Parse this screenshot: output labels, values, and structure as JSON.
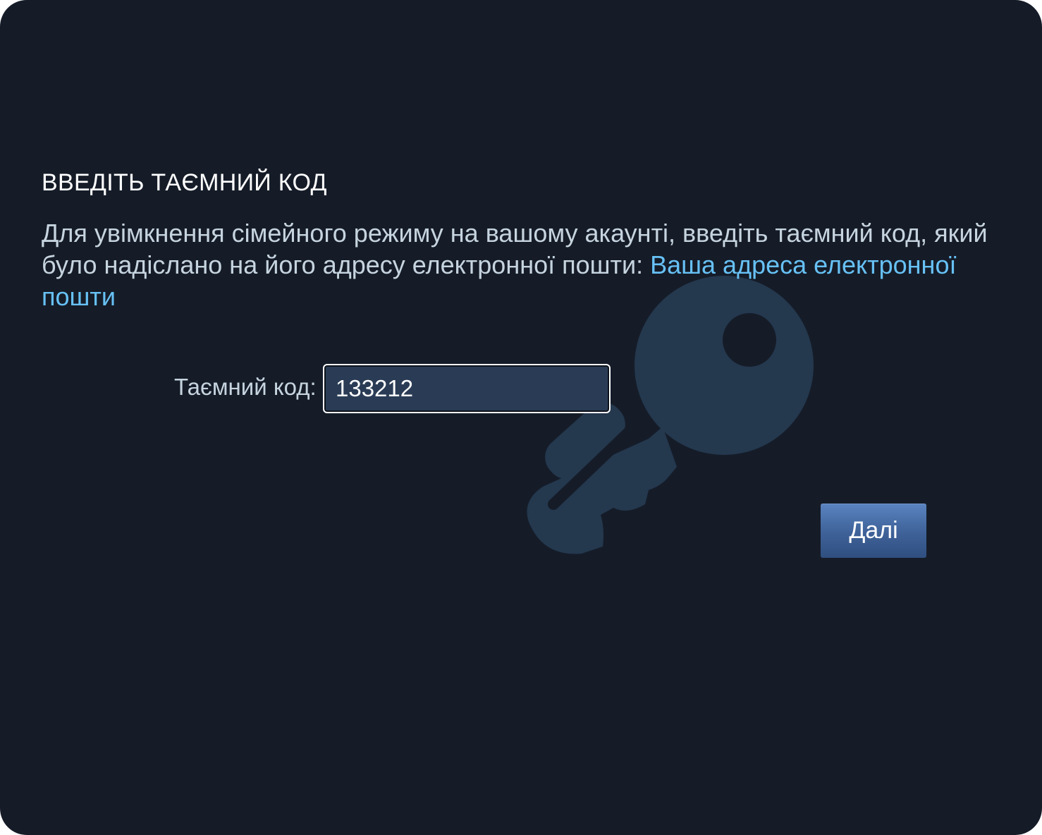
{
  "dialog": {
    "title": "ВВЕДІТЬ ТАЄМНИЙ КОД",
    "description_text": "Для увімкнення сімейного режиму на вашому акаунті, введіть таємний код, який було надіслано на його адресу електронної пошти: ",
    "email_link_text": "Ваша адреса електронної пошти",
    "code_label": "Таємний код:",
    "code_value": "133212",
    "next_button_label": "Далі",
    "watermark_icon": "key-icon"
  },
  "colors": {
    "background": "#151c28",
    "link": "#67c1f5",
    "text": "#c6d4df",
    "input_background": "#2a3c55",
    "button": "#4a6fa8"
  }
}
